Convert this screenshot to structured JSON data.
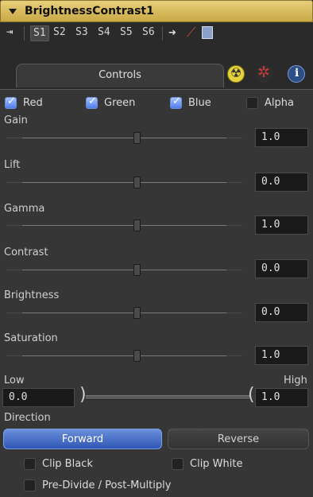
{
  "header": {
    "title": "BrightnessContrast1"
  },
  "toolbar": {
    "slots": [
      "S1",
      "S2",
      "S3",
      "S4",
      "S5",
      "S6"
    ],
    "active_slot": "S1"
  },
  "tabs": {
    "controls_label": "Controls",
    "icons": [
      "radioactive-icon",
      "gear-icon",
      "info-icon"
    ]
  },
  "channels": {
    "red": "Red",
    "green": "Green",
    "blue": "Blue",
    "alpha": "Alpha"
  },
  "sliders": {
    "gain": {
      "label": "Gain",
      "value": "1.0"
    },
    "lift": {
      "label": "Lift",
      "value": "0.0"
    },
    "gamma": {
      "label": "Gamma",
      "value": "1.0"
    },
    "contrast": {
      "label": "Contrast",
      "value": "0.0"
    },
    "brightness": {
      "label": "Brightness",
      "value": "0.0"
    },
    "saturation": {
      "label": "Saturation",
      "value": "1.0"
    }
  },
  "range": {
    "low_label": "Low",
    "high_label": "High",
    "low_value": "0.0",
    "high_value": "1.0"
  },
  "direction": {
    "label": "Direction",
    "forward": "Forward",
    "reverse": "Reverse",
    "selected": "Forward"
  },
  "options": {
    "clip_black": "Clip Black",
    "clip_white": "Clip White",
    "pre_divide": "Pre-Divide / Post-Multiply"
  },
  "colors": {
    "header": "#d7bb5c",
    "accent": "#4f7de8",
    "panel_bg": "#363636"
  }
}
